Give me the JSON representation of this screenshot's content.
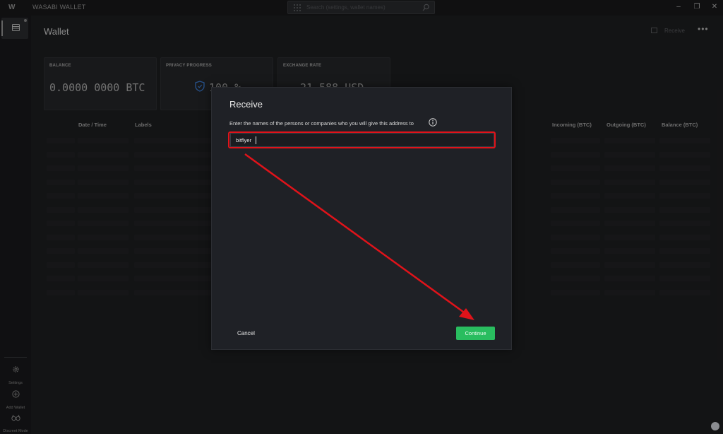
{
  "window": {
    "title": "WASABI WALLET",
    "search_placeholder": "Search (settings, wallet names)",
    "controls": {
      "minimize": "–",
      "restore": "❐",
      "close": "✕"
    }
  },
  "sidebar": {
    "items": [
      {
        "label": "Settings",
        "icon": "gear-icon"
      },
      {
        "label": "Add Wallet",
        "icon": "plus-circle-icon"
      },
      {
        "label": "Discreet Mode",
        "icon": "glasses-icon"
      }
    ]
  },
  "header": {
    "title": "Wallet",
    "receive_label": "Receive",
    "more": "•••"
  },
  "tiles": [
    {
      "label": "BALANCE",
      "value": "0.0000 0000 BTC"
    },
    {
      "label": "PRIVACY PROGRESS",
      "value": "100 %"
    },
    {
      "label": "EXCHANGE RATE",
      "value": "21,588 USD"
    }
  ],
  "table": {
    "columns": [
      "Date / Time",
      "Labels",
      "Incoming (BTC)",
      "Outgoing (BTC)",
      "Balance (BTC)"
    ]
  },
  "dialog": {
    "title": "Receive",
    "prompt": "Enter the names of the persons or companies who you will give this address to",
    "input_value": "bitflyer",
    "cancel_label": "Cancel",
    "continue_label": "Continue"
  },
  "colors": {
    "accent_green": "#29bd5f",
    "annotation_red": "#e0131a",
    "background": "#1e1f21",
    "dialog_bg": "#1f2126"
  }
}
